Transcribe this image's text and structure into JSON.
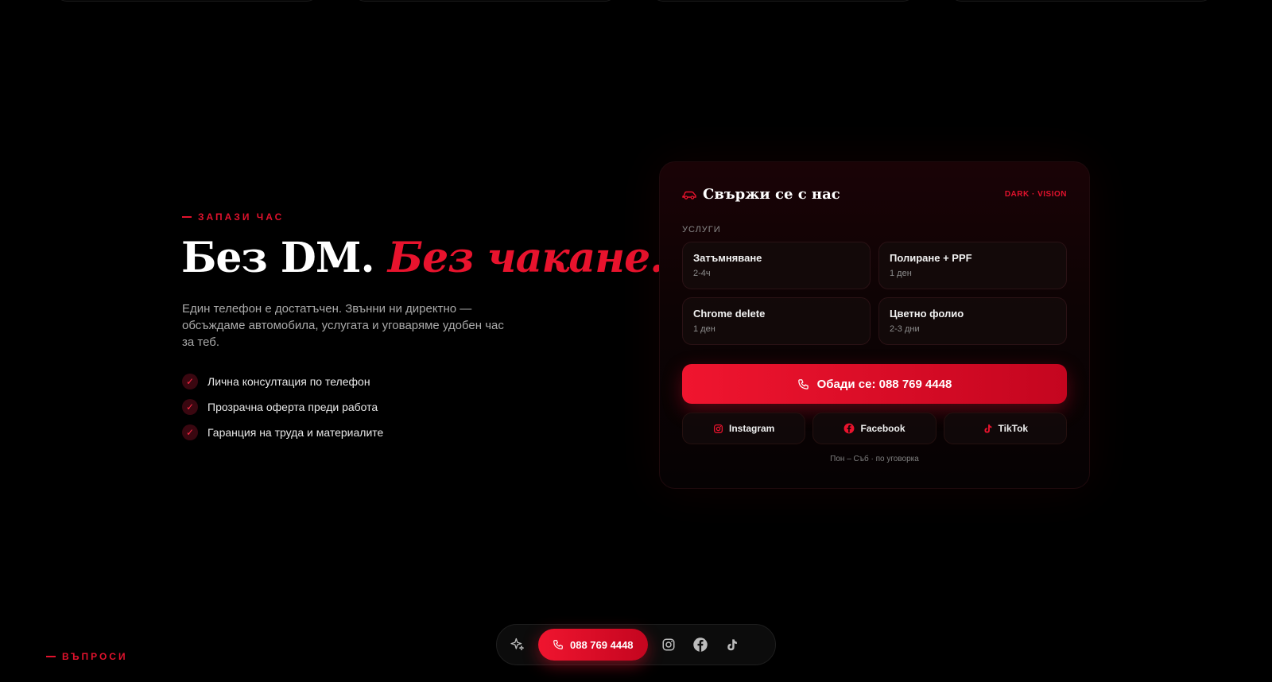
{
  "booking": {
    "eyebrow": "ЗАПАЗИ ЧАС",
    "headline_plain": "Без DM.",
    "headline_accent": "Без чакане.",
    "lead": "Един телефон е достатъчен. Звънни ни директно — обсъждаме автомобила, услугата и уговаряме удобен час за теб.",
    "checks": [
      "Лична консултация по телефон",
      "Прозрачна оферта преди работа",
      "Гаранция на труда и материалите"
    ]
  },
  "contact_card": {
    "title": "Свържи се с нас",
    "brand_tag": "DARK · VISION",
    "services_label": "УСЛУГИ",
    "services": [
      {
        "name": "Затъмняване",
        "time": "2-4ч"
      },
      {
        "name": "Полиране + PPF",
        "time": "1 ден"
      },
      {
        "name": "Chrome delete",
        "time": "1 ден"
      },
      {
        "name": "Цветно фолио",
        "time": "2-3 дни"
      }
    ],
    "call_label": "Обади се: 088 769 4448",
    "socials": [
      "Instagram",
      "Facebook",
      "TikTok"
    ],
    "hours": "Пон – Съб · по уговорка"
  },
  "faq": {
    "eyebrow": "ВЪПРОСИ"
  },
  "dock": {
    "call_label": "088 769 4448"
  },
  "colors": {
    "accent": "#e8132d",
    "background": "#000000"
  },
  "icons": [
    "car-icon",
    "phone-icon",
    "instagram-icon",
    "facebook-icon",
    "tiktok-icon",
    "sparkle-icon",
    "check-icon"
  ]
}
